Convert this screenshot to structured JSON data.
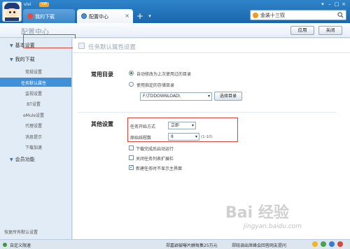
{
  "titlebar": {
    "username": "vivi",
    "vip_badge": "VIP",
    "tabs": [
      {
        "label": "我的下载"
      },
      {
        "label": "配置中心"
      }
    ],
    "search": {
      "value": "金装十三钗"
    }
  },
  "header": {
    "title": "配置中心",
    "apply_label": "应用",
    "close_label": "关闭"
  },
  "sidebar": {
    "groups": [
      {
        "label": "基本设置"
      },
      {
        "label": "我的下载"
      },
      {
        "label": "会员功能"
      }
    ],
    "items": [
      {
        "label": "常规设置"
      },
      {
        "label": "任务默认属性"
      },
      {
        "label": "监视设置"
      },
      {
        "label": "BT设置"
      },
      {
        "label": "eMule设置"
      },
      {
        "label": "代理设置"
      },
      {
        "label": "消息提示"
      },
      {
        "label": "下载加速"
      }
    ],
    "restore_label": "恢复所有默认设置"
  },
  "main": {
    "section_title": "任务默认属性设置",
    "common_dir": {
      "label": "常用目录",
      "option_auto": "自动修改为上次使用过的目录",
      "option_fixed": "使用指定的存储目录",
      "path": "F:\\TDDOWNLOAD\\",
      "browse_label": "选择目录"
    },
    "other": {
      "label": "其他设置",
      "start_mode_label": "任务开始方式",
      "start_mode_value": "立即",
      "conn_label": "原始线程数",
      "conn_value": "8",
      "conn_hint": "(1-10)",
      "cb_open_after": "下载完成后启动运行",
      "cb_close_list": "关闭任务列表扩展栏",
      "cb_no_panel": "新建任务时不显示主界面"
    }
  },
  "status": {
    "left_text": "自定义限速",
    "news1": "郑嘉颖被曝片酬每集25万元",
    "news2": "郑晓调出席峰会回答网友提问"
  },
  "watermark": {
    "logo": "Bai 经验",
    "url": "jingyan.baidu.com"
  },
  "colors": {
    "titlebar": "#2073bb",
    "active_item": "#3f8fd9",
    "highlight_outline": "#d9463a"
  }
}
